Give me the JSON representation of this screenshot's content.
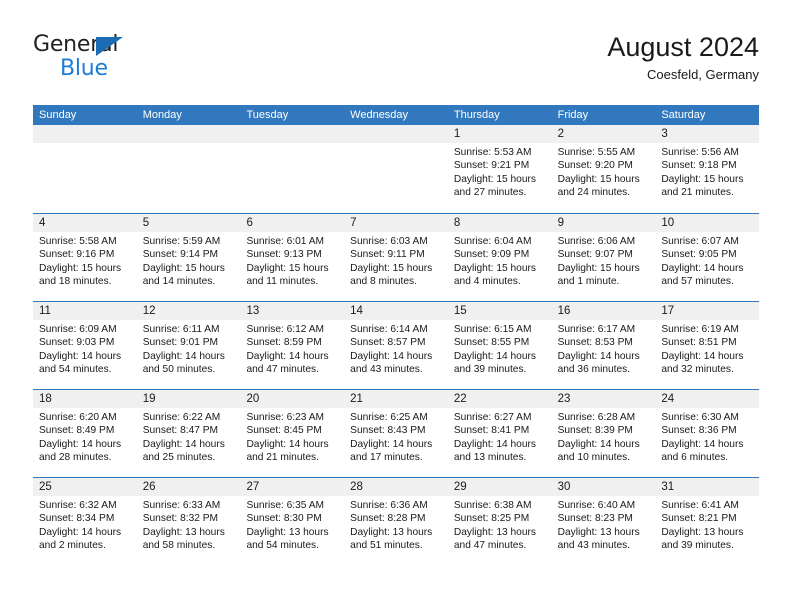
{
  "brand": {
    "name_part1": "General",
    "name_part2": "Blue",
    "triangle_color": "#1b6cb5",
    "blue_color": "#1b7fd4"
  },
  "header": {
    "title": "August 2024",
    "subtitle": "Coesfeld, Germany"
  },
  "theme": {
    "header_bg": "#3278be",
    "header_text": "#ffffff",
    "daynum_bg": "#f0f0f0",
    "cell_bg": "#ffffff",
    "row_divider": "#3278be",
    "body_text": "#1a1a1a"
  },
  "weekdays": [
    "Sunday",
    "Monday",
    "Tuesday",
    "Wednesday",
    "Thursday",
    "Friday",
    "Saturday"
  ],
  "weeks": [
    [
      {
        "day": ""
      },
      {
        "day": ""
      },
      {
        "day": ""
      },
      {
        "day": ""
      },
      {
        "day": "1",
        "sunrise": "Sunrise: 5:53 AM",
        "sunset": "Sunset: 9:21 PM",
        "daylight": "Daylight: 15 hours and 27 minutes."
      },
      {
        "day": "2",
        "sunrise": "Sunrise: 5:55 AM",
        "sunset": "Sunset: 9:20 PM",
        "daylight": "Daylight: 15 hours and 24 minutes."
      },
      {
        "day": "3",
        "sunrise": "Sunrise: 5:56 AM",
        "sunset": "Sunset: 9:18 PM",
        "daylight": "Daylight: 15 hours and 21 minutes."
      }
    ],
    [
      {
        "day": "4",
        "sunrise": "Sunrise: 5:58 AM",
        "sunset": "Sunset: 9:16 PM",
        "daylight": "Daylight: 15 hours and 18 minutes."
      },
      {
        "day": "5",
        "sunrise": "Sunrise: 5:59 AM",
        "sunset": "Sunset: 9:14 PM",
        "daylight": "Daylight: 15 hours and 14 minutes."
      },
      {
        "day": "6",
        "sunrise": "Sunrise: 6:01 AM",
        "sunset": "Sunset: 9:13 PM",
        "daylight": "Daylight: 15 hours and 11 minutes."
      },
      {
        "day": "7",
        "sunrise": "Sunrise: 6:03 AM",
        "sunset": "Sunset: 9:11 PM",
        "daylight": "Daylight: 15 hours and 8 minutes."
      },
      {
        "day": "8",
        "sunrise": "Sunrise: 6:04 AM",
        "sunset": "Sunset: 9:09 PM",
        "daylight": "Daylight: 15 hours and 4 minutes."
      },
      {
        "day": "9",
        "sunrise": "Sunrise: 6:06 AM",
        "sunset": "Sunset: 9:07 PM",
        "daylight": "Daylight: 15 hours and 1 minute."
      },
      {
        "day": "10",
        "sunrise": "Sunrise: 6:07 AM",
        "sunset": "Sunset: 9:05 PM",
        "daylight": "Daylight: 14 hours and 57 minutes."
      }
    ],
    [
      {
        "day": "11",
        "sunrise": "Sunrise: 6:09 AM",
        "sunset": "Sunset: 9:03 PM",
        "daylight": "Daylight: 14 hours and 54 minutes."
      },
      {
        "day": "12",
        "sunrise": "Sunrise: 6:11 AM",
        "sunset": "Sunset: 9:01 PM",
        "daylight": "Daylight: 14 hours and 50 minutes."
      },
      {
        "day": "13",
        "sunrise": "Sunrise: 6:12 AM",
        "sunset": "Sunset: 8:59 PM",
        "daylight": "Daylight: 14 hours and 47 minutes."
      },
      {
        "day": "14",
        "sunrise": "Sunrise: 6:14 AM",
        "sunset": "Sunset: 8:57 PM",
        "daylight": "Daylight: 14 hours and 43 minutes."
      },
      {
        "day": "15",
        "sunrise": "Sunrise: 6:15 AM",
        "sunset": "Sunset: 8:55 PM",
        "daylight": "Daylight: 14 hours and 39 minutes."
      },
      {
        "day": "16",
        "sunrise": "Sunrise: 6:17 AM",
        "sunset": "Sunset: 8:53 PM",
        "daylight": "Daylight: 14 hours and 36 minutes."
      },
      {
        "day": "17",
        "sunrise": "Sunrise: 6:19 AM",
        "sunset": "Sunset: 8:51 PM",
        "daylight": "Daylight: 14 hours and 32 minutes."
      }
    ],
    [
      {
        "day": "18",
        "sunrise": "Sunrise: 6:20 AM",
        "sunset": "Sunset: 8:49 PM",
        "daylight": "Daylight: 14 hours and 28 minutes."
      },
      {
        "day": "19",
        "sunrise": "Sunrise: 6:22 AM",
        "sunset": "Sunset: 8:47 PM",
        "daylight": "Daylight: 14 hours and 25 minutes."
      },
      {
        "day": "20",
        "sunrise": "Sunrise: 6:23 AM",
        "sunset": "Sunset: 8:45 PM",
        "daylight": "Daylight: 14 hours and 21 minutes."
      },
      {
        "day": "21",
        "sunrise": "Sunrise: 6:25 AM",
        "sunset": "Sunset: 8:43 PM",
        "daylight": "Daylight: 14 hours and 17 minutes."
      },
      {
        "day": "22",
        "sunrise": "Sunrise: 6:27 AM",
        "sunset": "Sunset: 8:41 PM",
        "daylight": "Daylight: 14 hours and 13 minutes."
      },
      {
        "day": "23",
        "sunrise": "Sunrise: 6:28 AM",
        "sunset": "Sunset: 8:39 PM",
        "daylight": "Daylight: 14 hours and 10 minutes."
      },
      {
        "day": "24",
        "sunrise": "Sunrise: 6:30 AM",
        "sunset": "Sunset: 8:36 PM",
        "daylight": "Daylight: 14 hours and 6 minutes."
      }
    ],
    [
      {
        "day": "25",
        "sunrise": "Sunrise: 6:32 AM",
        "sunset": "Sunset: 8:34 PM",
        "daylight": "Daylight: 14 hours and 2 minutes."
      },
      {
        "day": "26",
        "sunrise": "Sunrise: 6:33 AM",
        "sunset": "Sunset: 8:32 PM",
        "daylight": "Daylight: 13 hours and 58 minutes."
      },
      {
        "day": "27",
        "sunrise": "Sunrise: 6:35 AM",
        "sunset": "Sunset: 8:30 PM",
        "daylight": "Daylight: 13 hours and 54 minutes."
      },
      {
        "day": "28",
        "sunrise": "Sunrise: 6:36 AM",
        "sunset": "Sunset: 8:28 PM",
        "daylight": "Daylight: 13 hours and 51 minutes."
      },
      {
        "day": "29",
        "sunrise": "Sunrise: 6:38 AM",
        "sunset": "Sunset: 8:25 PM",
        "daylight": "Daylight: 13 hours and 47 minutes."
      },
      {
        "day": "30",
        "sunrise": "Sunrise: 6:40 AM",
        "sunset": "Sunset: 8:23 PM",
        "daylight": "Daylight: 13 hours and 43 minutes."
      },
      {
        "day": "31",
        "sunrise": "Sunrise: 6:41 AM",
        "sunset": "Sunset: 8:21 PM",
        "daylight": "Daylight: 13 hours and 39 minutes."
      }
    ]
  ]
}
